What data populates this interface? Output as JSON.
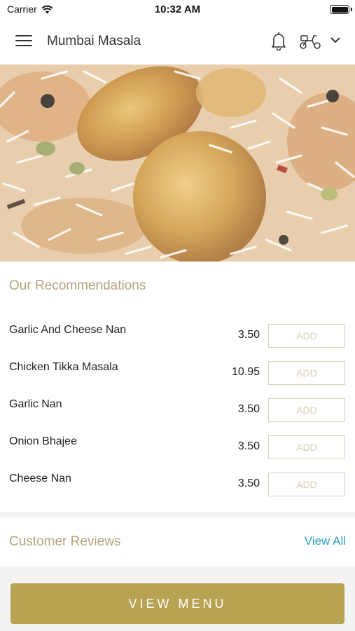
{
  "status_bar": {
    "carrier": "Carrier",
    "time": "10:32 AM"
  },
  "header": {
    "title": "Mumbai Masala",
    "icons": [
      "menu-icon",
      "bell-icon",
      "scooter-icon",
      "chevron-down-icon"
    ]
  },
  "hero": {
    "image": "chicken biryani photo"
  },
  "recommendations": {
    "title": "Our Recommendations",
    "add_label": "ADD",
    "items": [
      {
        "name": "Garlic And Cheese Nan",
        "price": "3.50"
      },
      {
        "name": "Chicken Tikka Masala",
        "price": "10.95"
      },
      {
        "name": "Garlic Nan",
        "price": "3.50"
      },
      {
        "name": "Onion Bhajee",
        "price": "3.50"
      },
      {
        "name": "Cheese Nan",
        "price": "3.50"
      }
    ]
  },
  "reviews": {
    "title": "Customer Reviews",
    "view_all": "View All"
  },
  "footer": {
    "view_menu": "VIEW MENU"
  },
  "colors": {
    "accent": "#b7a351",
    "label": "#b3a47c",
    "link": "#2f9fc6",
    "add_border": "#d8d1b8"
  }
}
